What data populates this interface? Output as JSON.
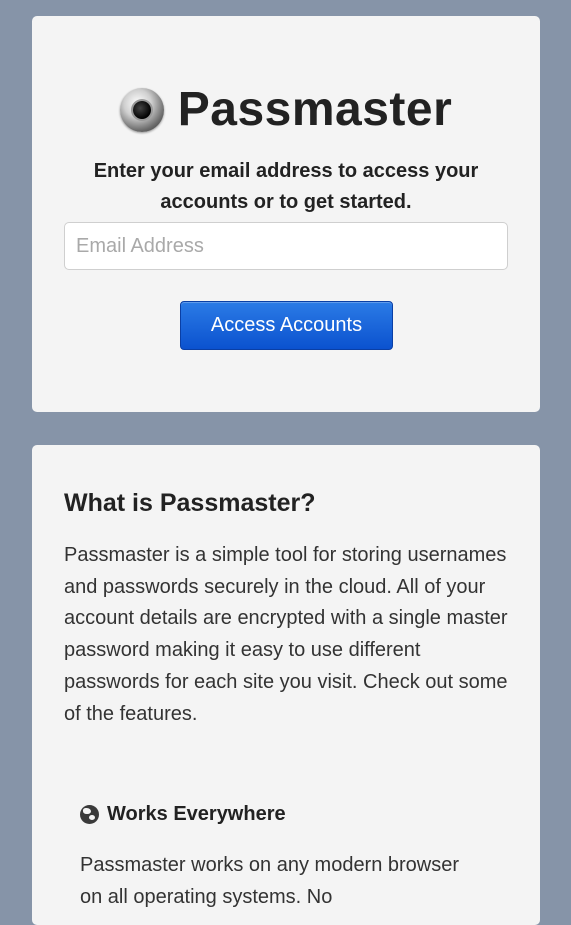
{
  "login": {
    "brand_name": "Passmaster",
    "subtitle": "Enter your email address to access your accounts or to get started.",
    "email_placeholder": "Email Address",
    "email_value": "",
    "access_button_label": "Access Accounts"
  },
  "info": {
    "title": "What is Passmaster?",
    "body": "Passmaster is a simple tool for storing usernames and passwords securely in the cloud. All of your account details are encrypted with a single master password making it easy to use different passwords for each site you visit. Check out some of the features.",
    "features": [
      {
        "icon": "globe-icon",
        "title": "Works Everywhere",
        "body": "Passmaster works on any modern browser on all operating systems. No"
      }
    ]
  },
  "colors": {
    "background": "#8694a8",
    "card": "#f4f4f4",
    "button": "#0b52cf"
  }
}
